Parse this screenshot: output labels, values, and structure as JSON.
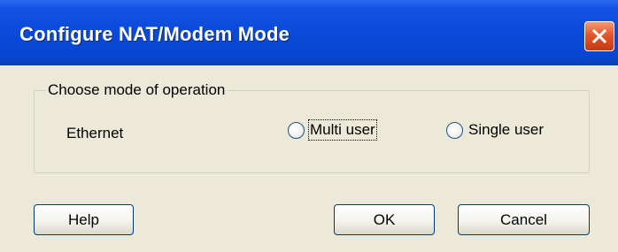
{
  "window": {
    "title": "Configure NAT/Modem Mode",
    "close_icon": "close-icon"
  },
  "group": {
    "legend": "Choose mode of operation",
    "interface_label": "Ethernet",
    "options": [
      {
        "label": "Multi user",
        "selected": false,
        "focused": true
      },
      {
        "label": "Single user",
        "selected": false,
        "focused": false
      }
    ]
  },
  "buttons": {
    "help": "Help",
    "ok": "OK",
    "cancel": "Cancel"
  },
  "colors": {
    "titlebar": "#0a4ad8",
    "close_button": "#e2582c",
    "dialog_bg": "#ece9d8",
    "button_border": "#003c74"
  }
}
